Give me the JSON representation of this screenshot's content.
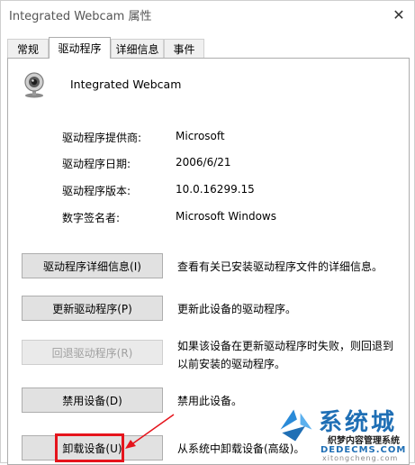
{
  "window": {
    "title": "Integrated Webcam 属性",
    "close_glyph": "✕"
  },
  "tabs": [
    {
      "label": "常规",
      "active": false
    },
    {
      "label": "驱动程序",
      "active": true
    },
    {
      "label": "详细信息",
      "active": false
    },
    {
      "label": "事件",
      "active": false
    }
  ],
  "device": {
    "name": "Integrated Webcam",
    "icon": "webcam-icon"
  },
  "properties": [
    {
      "label": "驱动程序提供商:",
      "value": "Microsoft"
    },
    {
      "label": "驱动程序日期:",
      "value": "2006/6/21"
    },
    {
      "label": "驱动程序版本:",
      "value": "10.0.16299.15"
    },
    {
      "label": "数字签名者:",
      "value": "Microsoft Windows"
    }
  ],
  "actions": [
    {
      "button": "驱动程序详细信息(I)",
      "desc_lines": [
        "查看有关已安装驱动程序文件的详细信息。"
      ],
      "enabled": true
    },
    {
      "button": "更新驱动程序(P)",
      "desc_lines": [
        "更新此设备的驱动程序。"
      ],
      "enabled": true
    },
    {
      "button": "回退驱动程序(R)",
      "desc_lines": [
        "如果该设备在更新驱动程序时失败，则回退到",
        "以前安装的驱动程序。"
      ],
      "enabled": false
    },
    {
      "button": "禁用设备(D)",
      "desc_lines": [
        "禁用此设备。"
      ],
      "enabled": true
    },
    {
      "button": "卸载设备(U)",
      "desc_lines": [
        "从系统中卸载设备(高级)。"
      ],
      "enabled": true
    }
  ],
  "annotation": {
    "highlight_color": "#e5141c"
  },
  "watermark": {
    "main": "系统城",
    "line1": "织梦内容管理系统",
    "line2": "DEDECMS.COM",
    "line3": "xitongcheng.com"
  },
  "colors": {
    "accent_blue": "#1f6fb5",
    "button_face": "#e1e1e1",
    "border": "#adadad"
  }
}
